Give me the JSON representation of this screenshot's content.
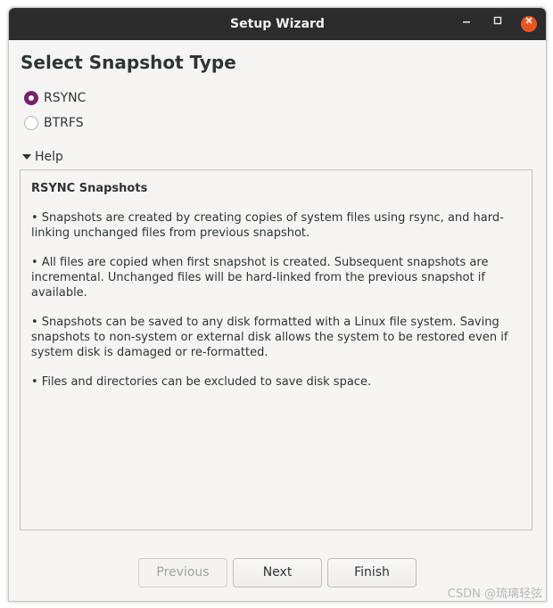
{
  "window": {
    "title": "Setup Wizard",
    "controls": {
      "minimize": "minimize-icon",
      "maximize": "maximize-icon",
      "close": "close-icon"
    },
    "close_color": "#e95420"
  },
  "page": {
    "heading": "Select Snapshot Type"
  },
  "snapshot_type": {
    "options": [
      {
        "label": "RSYNC",
        "selected": true
      },
      {
        "label": "BTRFS",
        "selected": false
      }
    ],
    "accent": "#77216f"
  },
  "help": {
    "expander_label": "Help",
    "expanded": true,
    "title": "RSYNC Snapshots",
    "paragraphs": [
      "• Snapshots are created by creating copies of system files using rsync, and hard-linking unchanged files from previous snapshot.",
      "• All files are copied when first snapshot is created. Subsequent snapshots are incremental. Unchanged files will be hard-linked from the previous snapshot if available.",
      "• Snapshots can be saved to any disk formatted with a Linux file system. Saving snapshots to non-system or external disk allows the system to be restored even if system disk is damaged or re-formatted.",
      "• Files and directories can be excluded to save disk space."
    ]
  },
  "buttons": {
    "previous": {
      "label": "Previous",
      "enabled": false
    },
    "next": {
      "label": "Next",
      "enabled": true
    },
    "finish": {
      "label": "Finish",
      "enabled": true
    }
  },
  "watermark": "CSDN @琉璃轻弦"
}
